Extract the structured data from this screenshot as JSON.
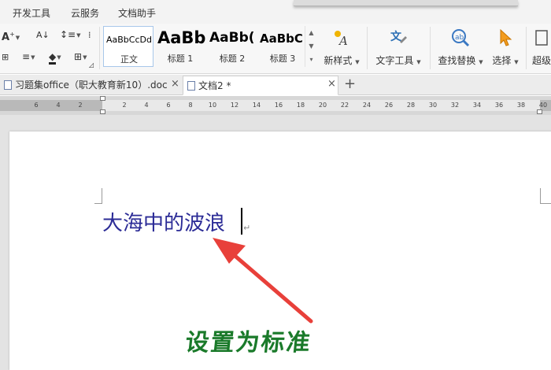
{
  "menu": {
    "items": [
      "开发工具",
      "云服务",
      "文档助手"
    ]
  },
  "ribbon": {
    "styles": [
      {
        "preview": "AaBbCcDd",
        "label": "正文"
      },
      {
        "preview": "AaBb",
        "label": "标题 1"
      },
      {
        "preview": "AaBb(",
        "label": "标题 2"
      },
      {
        "preview": "AaBbC",
        "label": "标题 3"
      }
    ],
    "buttons": {
      "new_style": "新样式",
      "text_tools": "文字工具",
      "find_replace": "查找替换",
      "select": "选择",
      "super": "超级"
    },
    "icons": {
      "font_grow": "A",
      "sort": "A↓",
      "indent": "≡",
      "fill": "◆",
      "border": "⊞"
    }
  },
  "tabs": [
    {
      "label": "习题集office（职大教育新10）.doc",
      "active": false
    },
    {
      "label": "文档2 *",
      "active": true
    }
  ],
  "ruler": {
    "labels": [
      "6",
      "4",
      "2",
      "2",
      "4",
      "6",
      "8",
      "10",
      "12",
      "14",
      "16",
      "18",
      "20",
      "22",
      "24",
      "26",
      "28",
      "30",
      "32",
      "34",
      "36",
      "38",
      "40"
    ]
  },
  "document": {
    "text": "大海中的波浪"
  },
  "annotation": {
    "text": "设置为标准",
    "arrow_color": "#e8403a",
    "text_color": "#1a7a2a"
  }
}
